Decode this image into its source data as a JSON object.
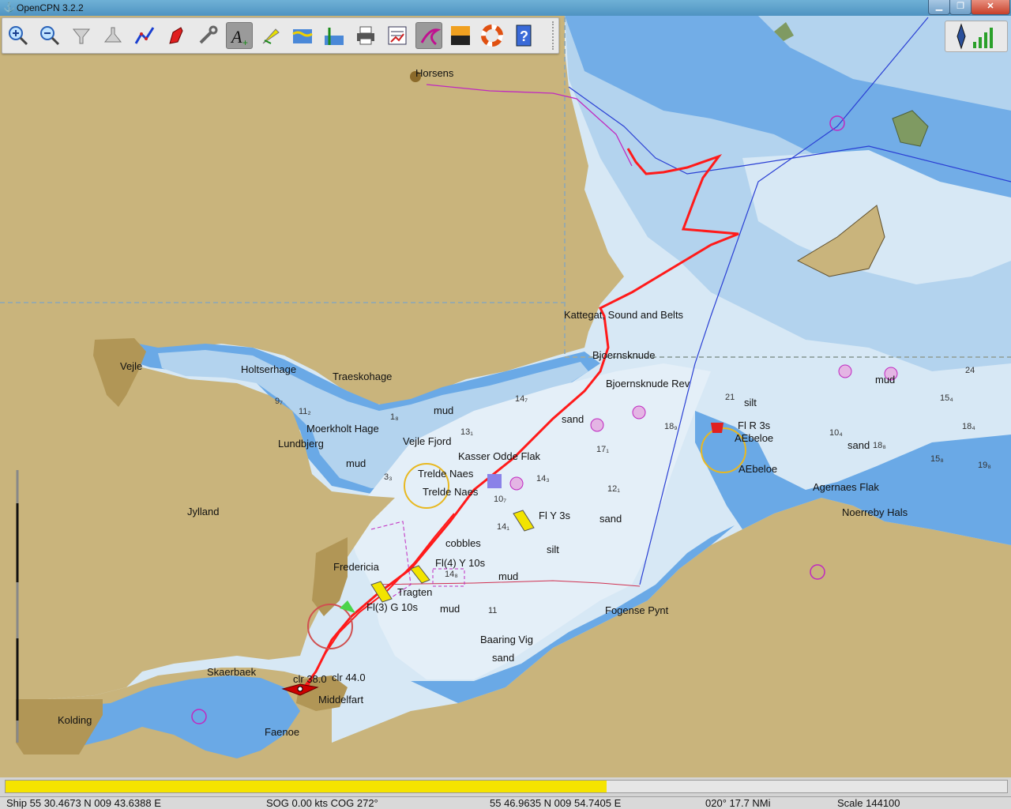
{
  "window": {
    "title": "OpenCPN 3.2.2",
    "minimize": "▁",
    "maximize": "❐",
    "close": "✕"
  },
  "toolbar": {
    "buttons": [
      {
        "name": "zoom-in",
        "icon": "zoom-in-icon"
      },
      {
        "name": "zoom-out",
        "icon": "zoom-out-icon"
      },
      {
        "name": "scale-in",
        "icon": "scale-in-icon"
      },
      {
        "name": "scale-out",
        "icon": "scale-out-icon"
      },
      {
        "name": "route",
        "icon": "route-icon"
      },
      {
        "name": "follow",
        "icon": "ship-follow-icon"
      },
      {
        "name": "settings",
        "icon": "wrench-icon"
      },
      {
        "name": "text",
        "icon": "text-toggle-icon",
        "active": true
      },
      {
        "name": "current",
        "icon": "current-icon"
      },
      {
        "name": "tide",
        "icon": "tide-icon"
      },
      {
        "name": "tide-level",
        "icon": "tide-level-icon"
      },
      {
        "name": "print",
        "icon": "print-icon"
      },
      {
        "name": "route-manager",
        "icon": "route-manager-icon"
      },
      {
        "name": "track",
        "icon": "track-icon",
        "active": true
      },
      {
        "name": "colorscheme",
        "icon": "color-scheme-icon"
      },
      {
        "name": "mob",
        "icon": "man-overboard-icon"
      },
      {
        "name": "help",
        "icon": "help-icon"
      }
    ]
  },
  "chart_labels": {
    "horsens": "Horsens",
    "kattegat": "Kattegat, Sound and Belts",
    "bjoernsknude": "Bjoernsknude",
    "bjoernsknude_rev": "Bjoernsknude Rev",
    "vejle": "Vejle",
    "holtserhage": "Holtserhage",
    "traeskohage": "Traeskohage",
    "mud1": "mud",
    "moerkholt": "Moerkholt Hage",
    "vejle_fjord": "Vejle Fjord",
    "lundbjerg": "Lundbjerg",
    "mud2": "mud",
    "kasser": "Kasser Odde Flak",
    "trelde1": "Trelde Naes",
    "trelde2": "Trelde Naes",
    "jylland": "Jylland",
    "fly3s": "Fl Y 3s",
    "sand1": "sand",
    "cobbles": "cobbles",
    "silt1": "silt",
    "fredericia": "Fredericia",
    "fl4": "Fl(4) Y 10s",
    "mud3": "mud",
    "tragten": "Tragten",
    "fl3": "Fl(3) G 10s",
    "mud4": "mud",
    "fogense": "Fogense Pynt",
    "baaring": "Baaring Vig",
    "sand2": "sand",
    "skaerbaek": "Skaerbaek",
    "clr1": "clr 38.0",
    "clr2": "clr 44.0",
    "middelfart": "Middelfart",
    "kolding": "Kolding",
    "faenoe": "Faenoe",
    "silt2": "silt",
    "sand3": "sand",
    "flr3s": "Fl R 3s",
    "aebeloe1": "AEbeloe",
    "aebeloe2": "AEbeloe",
    "sand4": "sand",
    "agernaes": "Agernaes Flak",
    "noerreby": "Noerreby Hals",
    "mud5": "mud",
    "silt3": "silt",
    "d147": "14₇",
    "d131": "13₁",
    "d171": "17₁",
    "d189": "18₉",
    "d143": "14₃",
    "d121": "12₁",
    "d107": "10₇",
    "d141": "14₁",
    "d33": "3₃",
    "d11": "11",
    "d24": "24",
    "d21": "21",
    "d154": "15₄",
    "d184": "18₄",
    "d104": "10₄",
    "d188": "18₈",
    "d158": "15₈",
    "d198": "19₈",
    "d97": "9₇",
    "d112": "11₂",
    "d18": "1₈",
    "d148": "14₈"
  },
  "progress": {
    "value": 0.6
  },
  "status": {
    "ship": "Ship 55 30.4673 N   009 43.6388 E",
    "sog": "SOG 0.00 kts   COG 272°",
    "cursor": "55 46.9635 N   009 54.7405 E",
    "bearing": "020°   17.7 NMi",
    "scale": "Scale 144100"
  },
  "colors": {
    "land": "#c9b47c",
    "deep": "#d7e8f5",
    "medium": "#b3d3ee",
    "shallow": "#6aa9e6",
    "track": "#ff1a1a"
  }
}
